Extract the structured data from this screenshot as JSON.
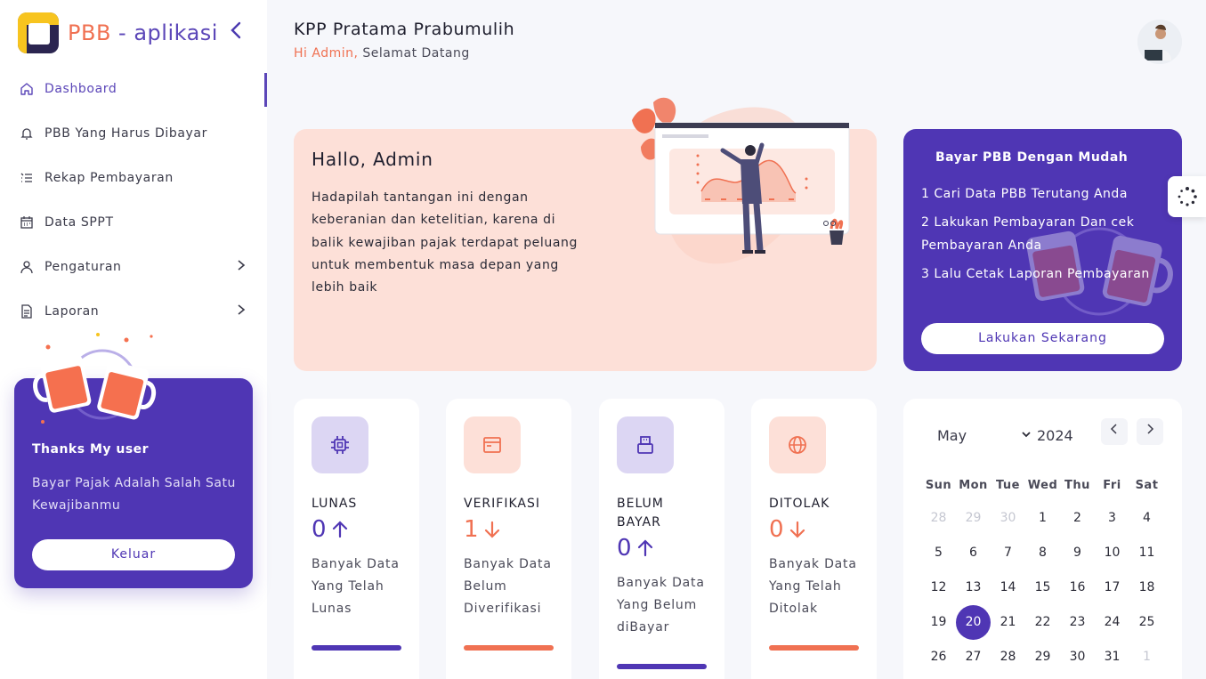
{
  "app": {
    "brand_part1": "PBB",
    "brand_part2": "- aplikasi"
  },
  "sidebar": {
    "items": [
      {
        "label": "Dashboard",
        "icon": "home-icon",
        "active": true
      },
      {
        "label": "PBB Yang Harus Dibayar",
        "icon": "bell-icon"
      },
      {
        "label": "Rekap Pembayaran",
        "icon": "list-icon"
      },
      {
        "label": "Data SPPT",
        "icon": "calendar-icon"
      },
      {
        "label": "Pengaturan",
        "icon": "user-icon",
        "has_submenu": true
      },
      {
        "label": "Laporan",
        "icon": "file-icon",
        "has_submenu": true
      }
    ],
    "thanks": {
      "title": "Thanks My user",
      "text": "Bayar Pajak Adalah Salah Satu Kewajibanmu",
      "button": "Keluar"
    }
  },
  "header": {
    "title": "KPP Pratama Prabumulih",
    "greeting_hi": "Hi Admin,",
    "greeting_rest": "Selamat Datang"
  },
  "hero": {
    "title": "Hallo, Admin",
    "text": "Hadapilah tantangan ini dengan keberanian dan ketelitian, karena di balik kewajiban pajak terdapat peluang untuk membentuk masa depan yang lebih baik"
  },
  "promo": {
    "title": "Bayar PBB Dengan Mudah",
    "steps": [
      "1 Cari Data PBB Terutang Anda",
      "2 Lakukan Pembayaran Dan cek Pembayaran Anda",
      "3 Lalu Cetak Laporan Pembayaran"
    ],
    "button": "Lakukan Sekarang"
  },
  "stats": [
    {
      "label": "LUNAS",
      "value": "0",
      "arrow": "up",
      "desc": "Banyak Data Yang Telah Lunas",
      "icon": "chip-icon",
      "color": "#4f36b4",
      "bg": "#dcd6f3"
    },
    {
      "label": "VERIFIKASI",
      "value": "1",
      "arrow": "down",
      "desc": "Banyak Data Belum Diverifikasi",
      "icon": "window-icon",
      "color": "#f07152",
      "bg": "#fde0d8"
    },
    {
      "label": "BELUM BAYAR",
      "value": "0",
      "arrow": "up",
      "desc": "Banyak Data Yang Belum diBayar",
      "icon": "usb-icon",
      "color": "#4f36b4",
      "bg": "#dcd6f3"
    },
    {
      "label": "DITOLAK",
      "value": "0",
      "arrow": "down",
      "desc": "Banyak Data Yang Telah Ditolak",
      "icon": "globe-icon",
      "color": "#f07152",
      "bg": "#fde0d8"
    }
  ],
  "calendar": {
    "month": "May",
    "year": "2024",
    "weekdays": [
      "Sun",
      "Mon",
      "Tue",
      "Wed",
      "Thu",
      "Fri",
      "Sat"
    ],
    "today": "20",
    "weeks": [
      [
        {
          "d": "28",
          "m": true
        },
        {
          "d": "29",
          "m": true
        },
        {
          "d": "30",
          "m": true
        },
        {
          "d": "1"
        },
        {
          "d": "2"
        },
        {
          "d": "3"
        },
        {
          "d": "4"
        }
      ],
      [
        {
          "d": "5"
        },
        {
          "d": "6"
        },
        {
          "d": "7"
        },
        {
          "d": "8"
        },
        {
          "d": "9"
        },
        {
          "d": "10"
        },
        {
          "d": "11"
        }
      ],
      [
        {
          "d": "12"
        },
        {
          "d": "13"
        },
        {
          "d": "14"
        },
        {
          "d": "15"
        },
        {
          "d": "16"
        },
        {
          "d": "17"
        },
        {
          "d": "18"
        }
      ],
      [
        {
          "d": "19"
        },
        {
          "d": "20"
        },
        {
          "d": "21"
        },
        {
          "d": "22"
        },
        {
          "d": "23"
        },
        {
          "d": "24"
        },
        {
          "d": "25"
        }
      ],
      [
        {
          "d": "26"
        },
        {
          "d": "27"
        },
        {
          "d": "28"
        },
        {
          "d": "29"
        },
        {
          "d": "30"
        },
        {
          "d": "31"
        },
        {
          "d": "1",
          "m": true
        }
      ]
    ]
  },
  "colors": {
    "primary": "#4f36b4",
    "accent": "#f07152",
    "hero_bg": "#fde0d8"
  }
}
